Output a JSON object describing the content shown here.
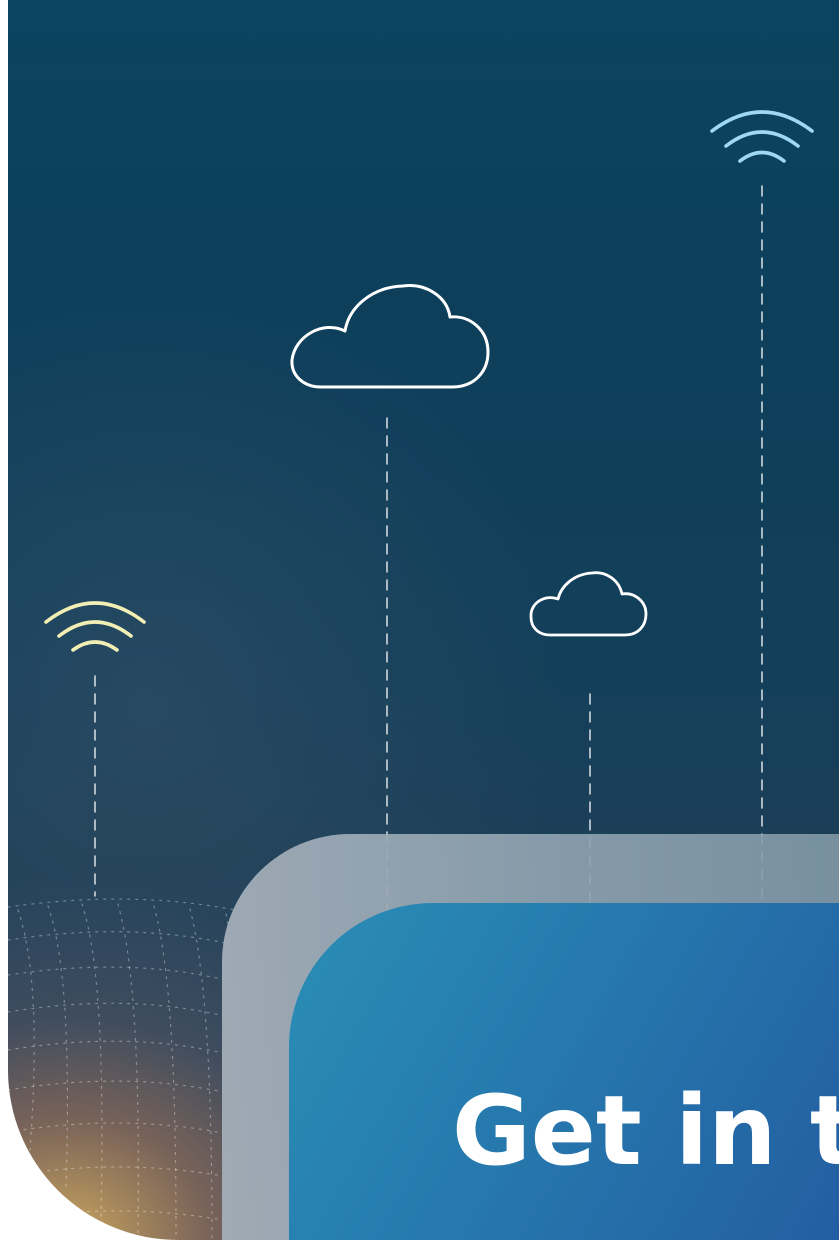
{
  "card": {
    "title": "Get in t"
  },
  "icons": {
    "clouds": [
      "cloud-icon",
      "cloud-icon"
    ],
    "signals": [
      "wifi-signal-icon",
      "wifi-signal-icon"
    ],
    "grid": "wire-grid-globe-icon"
  },
  "colors": {
    "hero_top": "#0b4460",
    "hero_bottom_glow": "#d2aa5f",
    "card_front": "#2678ad",
    "card_back": "#8ea2b0",
    "wifi_cyan": "#9ed8f5",
    "wifi_yellow": "#f2efb5",
    "line_white": "#ffffff"
  }
}
